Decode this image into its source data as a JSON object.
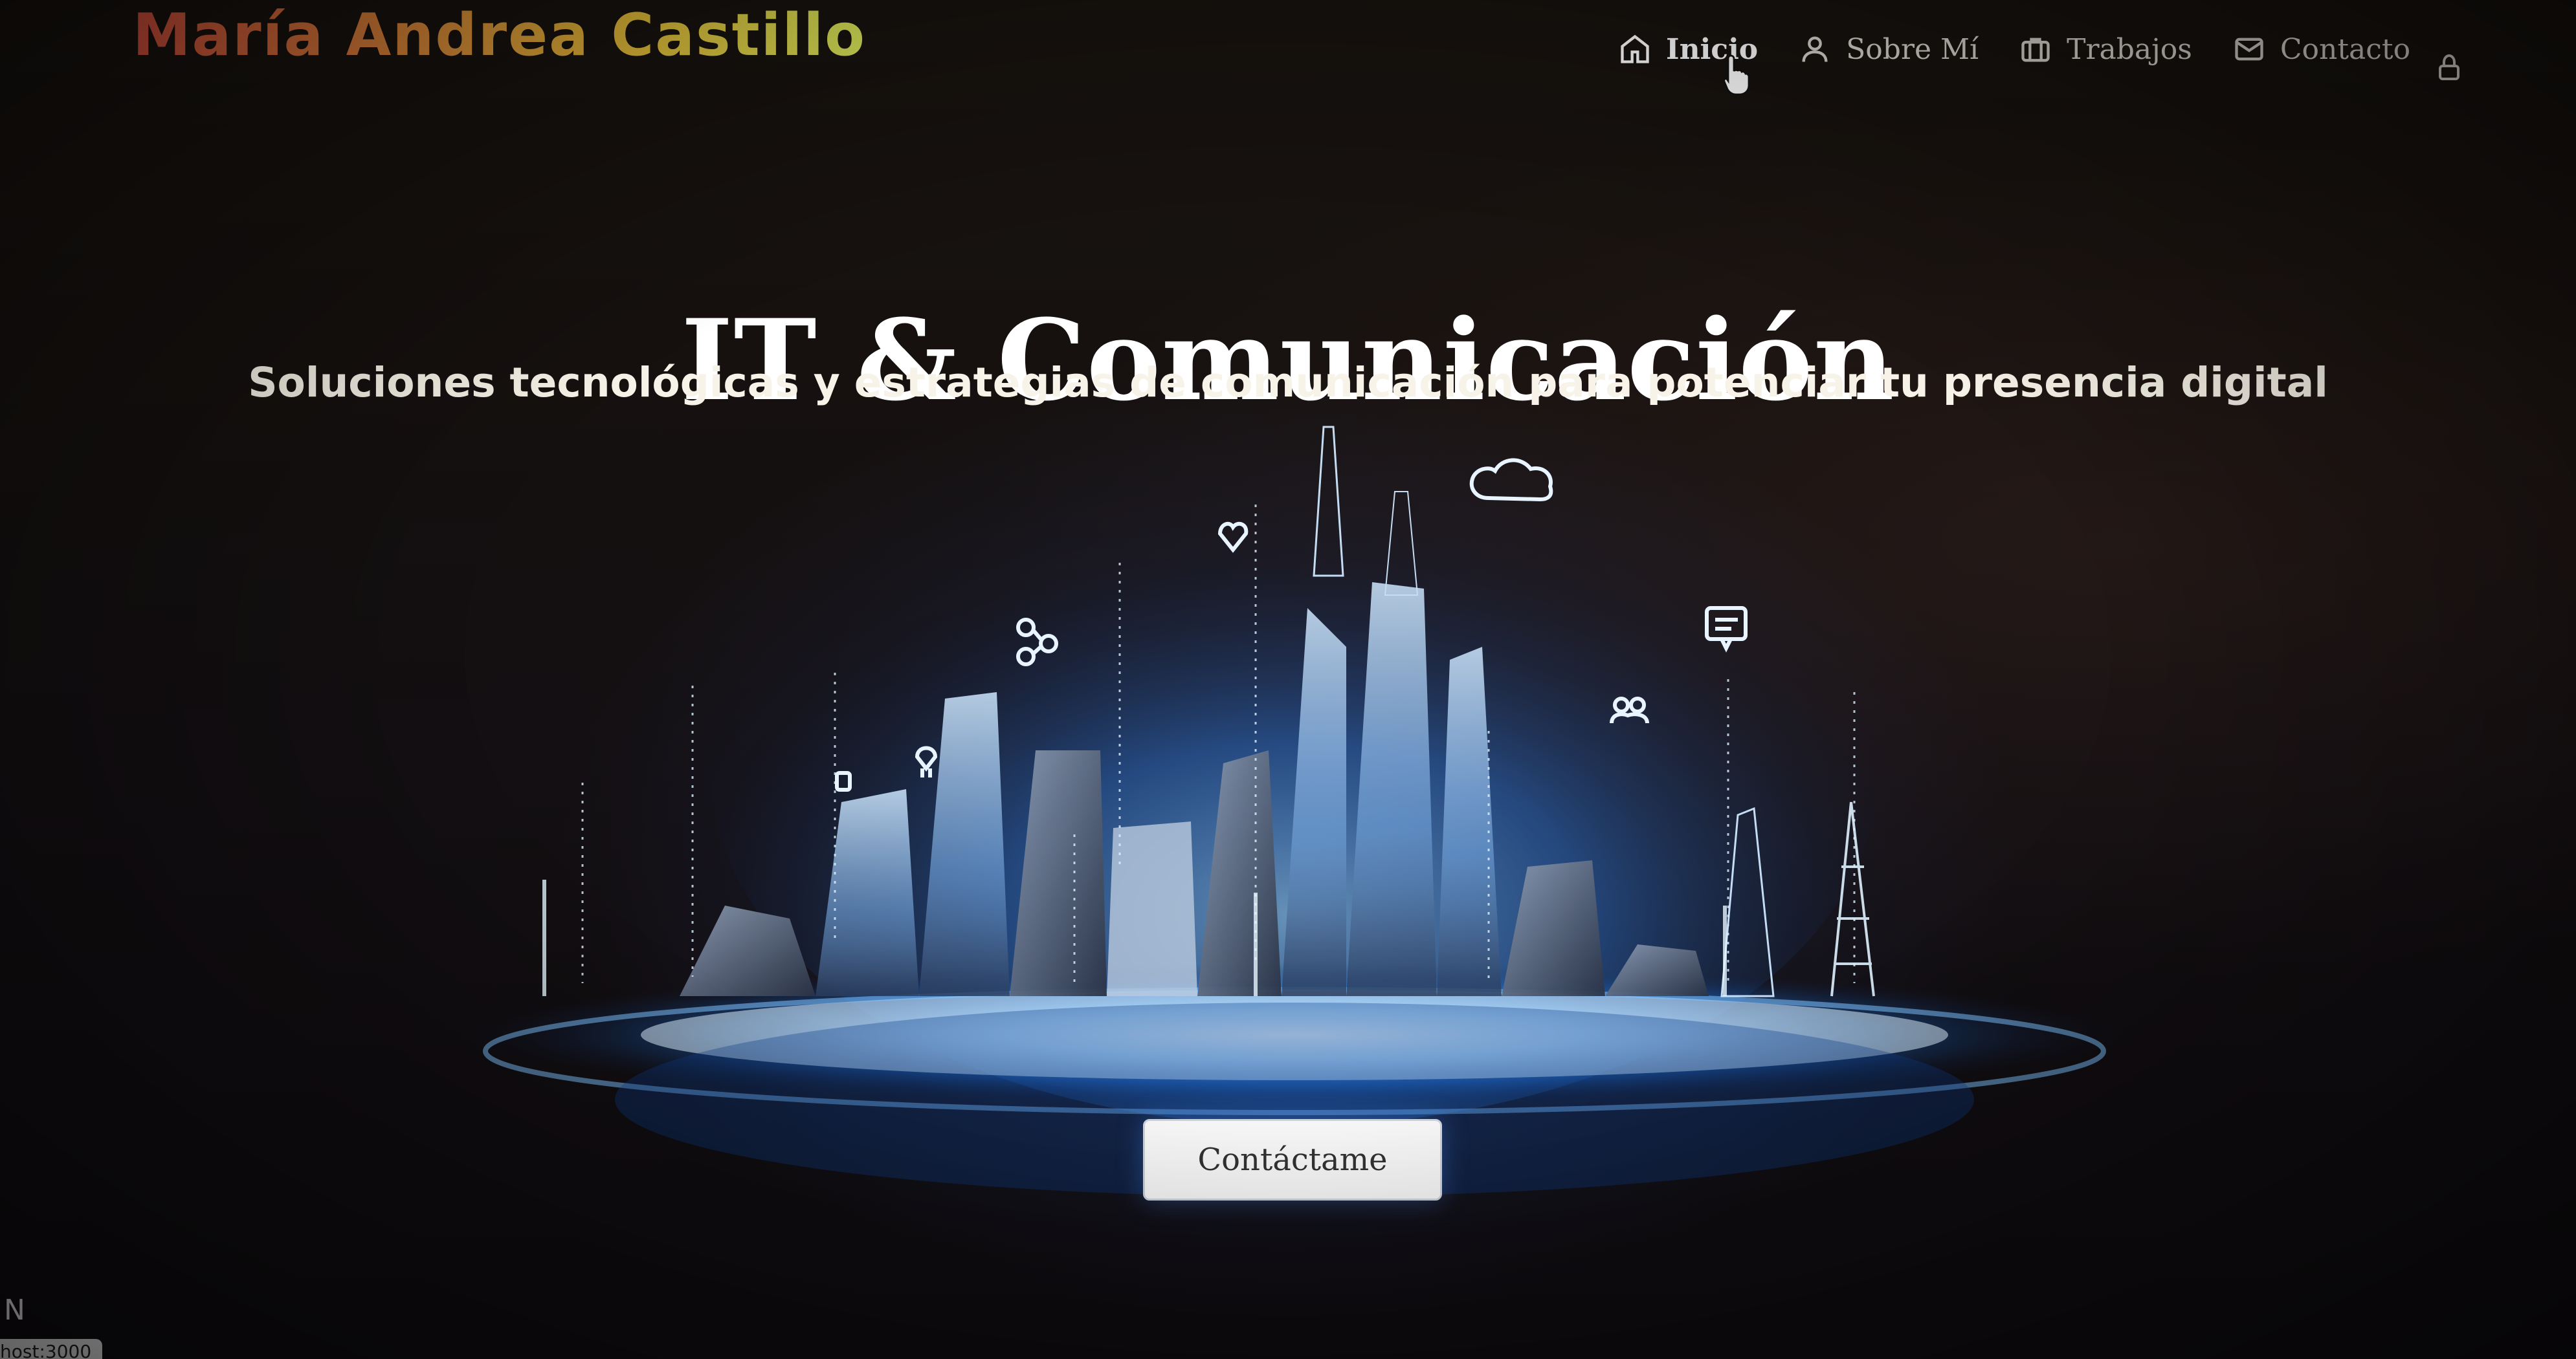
{
  "header": {
    "brand": "María Andrea Castillo",
    "nav": [
      {
        "label": "Inicio",
        "icon": "home-icon",
        "active": true
      },
      {
        "label": "Sobre Mí",
        "icon": "user-icon",
        "active": false
      },
      {
        "label": "Trabajos",
        "icon": "briefcase-icon",
        "active": false
      },
      {
        "label": "Contacto",
        "icon": "mail-icon",
        "active": false
      }
    ],
    "lock_icon": "lock-icon"
  },
  "hero": {
    "title": "IT & Comunicación",
    "subtitle": "Soluciones tecnológicas y estrategias de comunicación para potenciar tu presencia digital",
    "cta_label": "Contáctame"
  },
  "footer": {
    "dev_indicator": "N",
    "status_text": "host:3000"
  },
  "colors": {
    "background": "#110e10",
    "brand_gradient_start": "#d9513e",
    "brand_gradient_end": "#d9e85a",
    "hero_glow": "#4aa3ff",
    "cta_background": "#fbfbfb"
  }
}
